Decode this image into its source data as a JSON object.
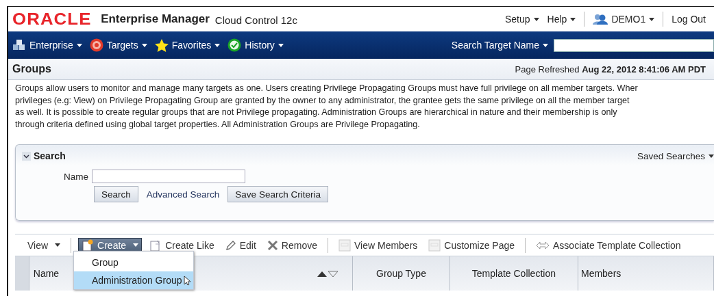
{
  "header": {
    "logo": "ORACLE",
    "product": "Enterprise Manager",
    "edition": "Cloud Control 12c",
    "links": [
      {
        "label": "Setup",
        "dropdown": true
      },
      {
        "label": "Help",
        "dropdown": true
      },
      {
        "label": "DEMO1",
        "dropdown": true
      },
      {
        "label": "Log Out",
        "dropdown": false
      }
    ]
  },
  "nav": {
    "items": [
      {
        "label": "Enterprise"
      },
      {
        "label": "Targets"
      },
      {
        "label": "Favorites"
      },
      {
        "label": "History"
      }
    ],
    "search_label": "Search Target Name"
  },
  "page": {
    "title": "Groups",
    "refreshed": "Page Refreshed **Aug 22, 2012 8:41:06 AM PDT**",
    "description": "Groups allow users to monitor and manage many targets as one. Users creating Privilege Propagating Groups must have full privilege on all member targets. Wher\nprivileges (e.g: View) on Privilege Propagating Group are granted by the owner to any administrator, the grantee gets the same privilege on all the member target\nas well. It is possible to create regular groups that are not Privilege propagating. Administration Groups are hierarchical in nature and their membership is only\nthrough criteria defined using global target properties. All Administration Groups are Privilege Propagating."
  },
  "search": {
    "title": "Search",
    "expanded": true,
    "saved_searches": "Saved Searches",
    "field_label": "Name",
    "buttons": [
      {
        "label": "Search",
        "kind": "button"
      },
      {
        "label": "Advanced Search",
        "kind": "link"
      },
      {
        "label": "Save Search Criteria",
        "kind": "button"
      }
    ]
  },
  "toolbar": {
    "groups": [
      [
        {
          "label": "View",
          "dropdown": true,
          "active": false
        }
      ],
      [
        {
          "label": "Create",
          "dropdown": true,
          "active": true
        },
        {
          "label": "Create Like",
          "dropdown": false,
          "active": false
        },
        {
          "label": "Edit",
          "dropdown": false,
          "active": false
        },
        {
          "label": "Remove",
          "dropdown": false,
          "active": false
        }
      ],
      [
        {
          "label": "View Members",
          "dropdown": false,
          "active": false
        },
        {
          "label": "Customize Page",
          "dropdown": false,
          "active": false
        }
      ],
      [
        {
          "label": "Associate Template Collection",
          "dropdown": false,
          "active": false
        }
      ]
    ]
  },
  "create_menu": [
    {
      "label": "Group",
      "selected": false
    },
    {
      "label": "Administration Group",
      "selected": true
    }
  ],
  "table": {
    "columns": [
      {
        "label": "Name",
        "sortable": true
      },
      {
        "label": "Group Type",
        "sortable": false
      },
      {
        "label": "Template Collection",
        "sortable": false
      },
      {
        "label": "Members",
        "sortable": false
      }
    ]
  }
}
